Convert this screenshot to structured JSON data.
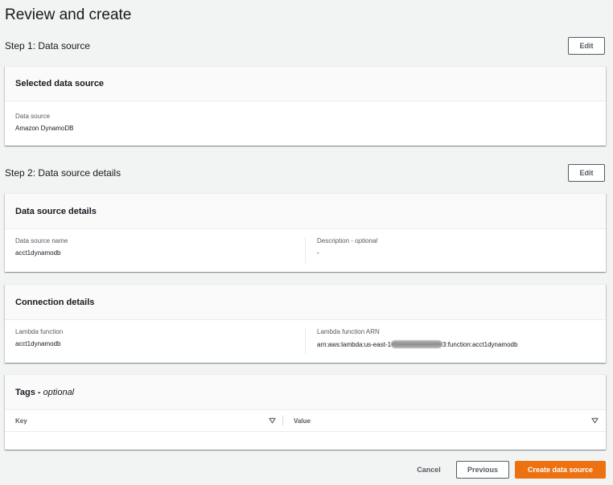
{
  "page": {
    "title": "Review and create"
  },
  "step1": {
    "title": "Step 1: Data source",
    "edit_label": "Edit",
    "card": {
      "header": "Selected data source",
      "fields": [
        {
          "label": "Data source",
          "value": "Amazon DynamoDB"
        }
      ]
    }
  },
  "step2": {
    "title": "Step 2: Data source details",
    "edit_label": "Edit",
    "details_card": {
      "header": "Data source details",
      "fields": [
        {
          "label": "Data source name",
          "value": "acct1dynamodb"
        },
        {
          "label": "Description",
          "label_suffix": "optional",
          "value": "-"
        }
      ]
    },
    "connection_card": {
      "header": "Connection details",
      "fields": [
        {
          "label": "Lambda function",
          "value": "acct1dynamodb"
        },
        {
          "label": "Lambda function ARN",
          "value_prefix": "arn:aws:lambda:us-east-1",
          "value_suffix": "3:function:acct1dynamodb"
        }
      ]
    }
  },
  "tags": {
    "header": "Tags",
    "header_suffix": "optional",
    "columns": [
      {
        "label": "Key"
      },
      {
        "label": "Value"
      }
    ]
  },
  "footer": {
    "cancel_label": "Cancel",
    "previous_label": "Previous",
    "create_label": "Create data source"
  },
  "colors": {
    "primary": "#ec7211",
    "background": "#f2f3f3",
    "text": "#16191f",
    "muted": "#545b64"
  }
}
